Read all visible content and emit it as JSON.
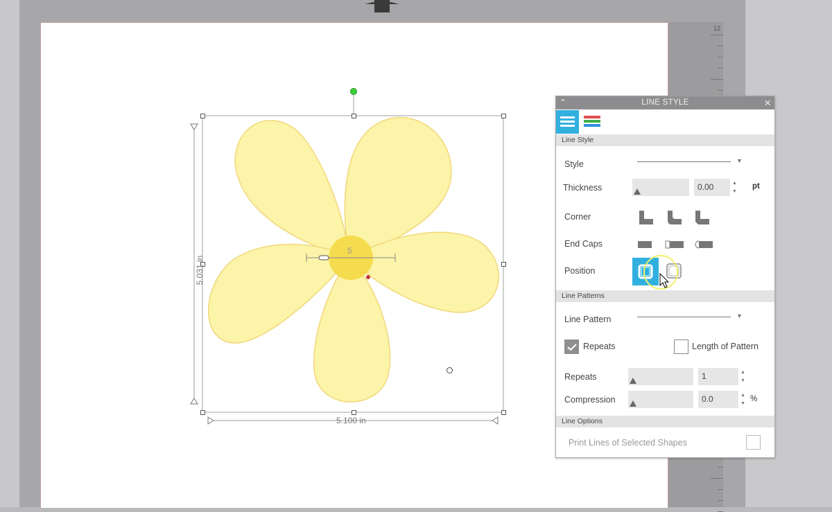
{
  "panel": {
    "title": "LINE STYLE",
    "tabs": [
      {
        "name": "line-style-tab",
        "icon": "line-style-icon",
        "active": true
      },
      {
        "name": "line-color-tab",
        "icon": "line-color-icon",
        "active": false
      }
    ],
    "sections": {
      "line_style": "Line Style",
      "line_patterns": "Line Patterns",
      "line_options": "Line Options"
    },
    "style_label": "Style",
    "thickness_label": "Thickness",
    "thickness_value": "0.00",
    "thickness_unit": "pt",
    "corner_label": "Corner",
    "endcaps_label": "End Caps",
    "position_label": "Position",
    "line_pattern_label": "Line Pattern",
    "repeats_checkbox_label": "Repeats",
    "length_of_pattern_label": "Length of Pattern",
    "repeats_label": "Repeats",
    "repeats_value": "1",
    "compression_label": "Compression",
    "compression_value": "0.0",
    "compression_unit": "%",
    "print_lines_label": "Print Lines of Selected Shapes"
  },
  "canvas": {
    "width_dimension": "5.100 in",
    "height_dimension": "5.031 in",
    "center_label": "5",
    "ruler_number": "12"
  },
  "colors": {
    "accent": "#31b0e0",
    "petal_fill": "#fcf4a8",
    "petal_stroke": "#f1d77a",
    "center_fill": "#f5dc4e"
  }
}
